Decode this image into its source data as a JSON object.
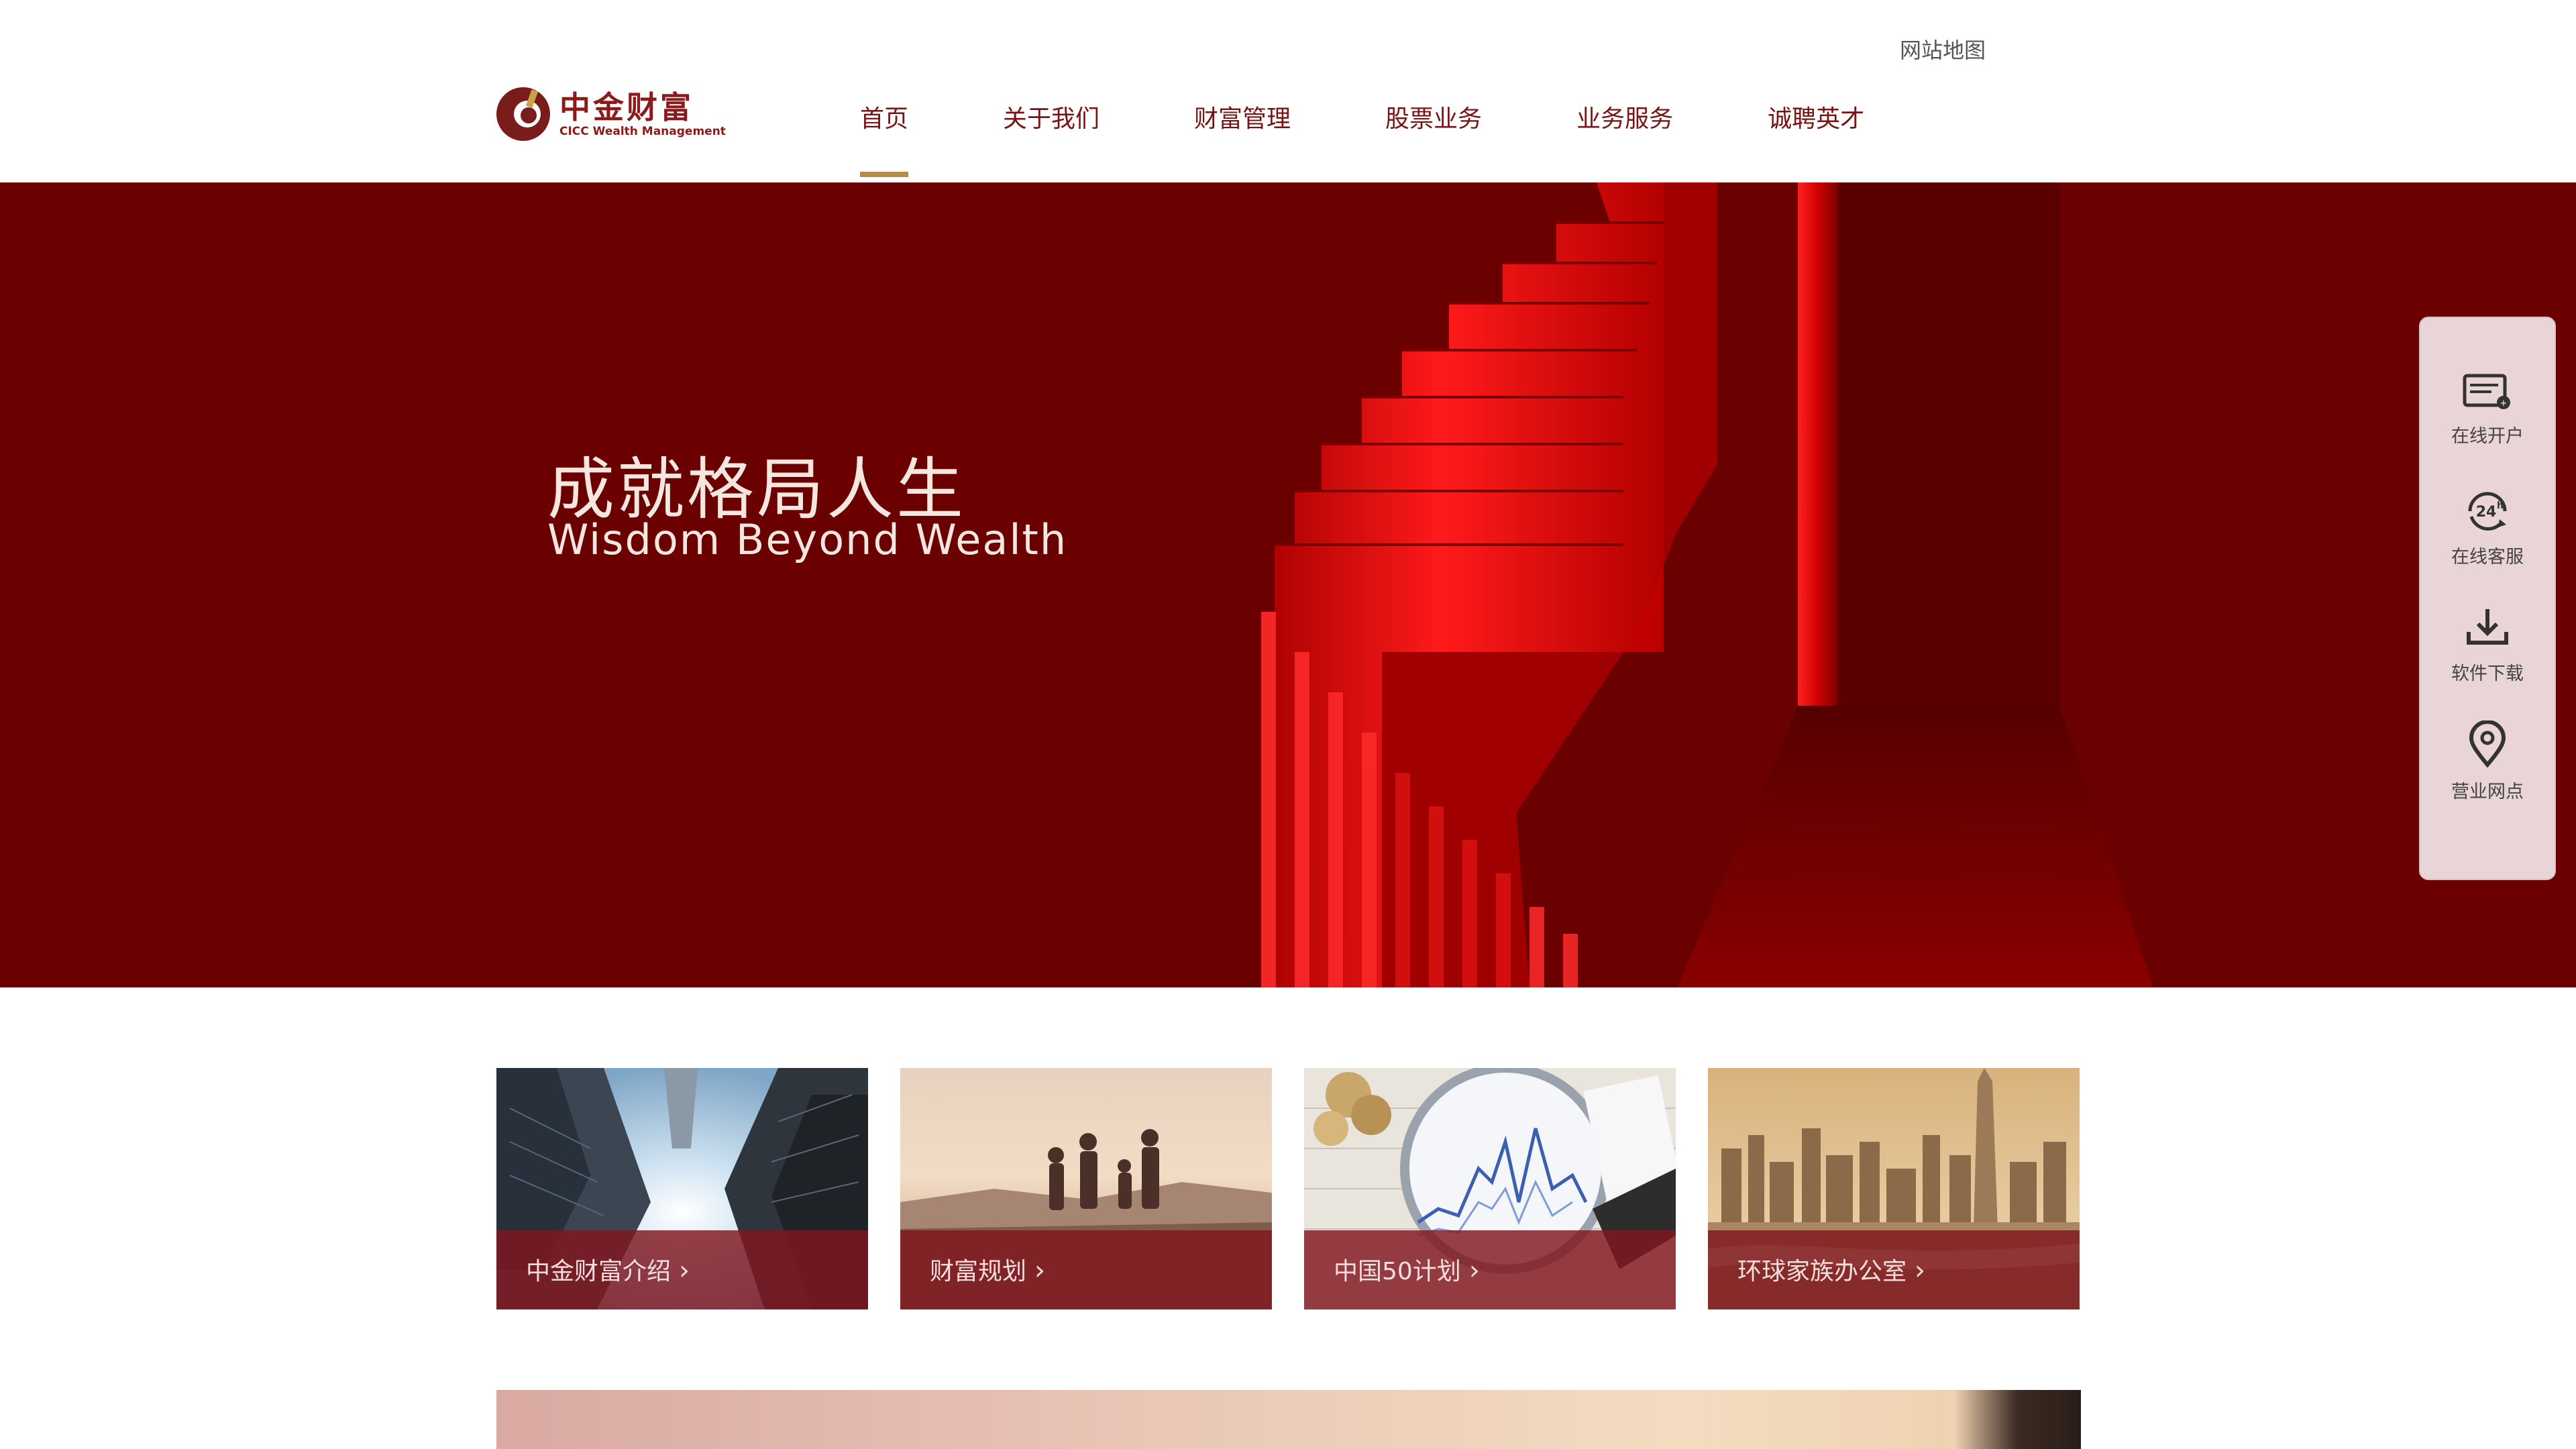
{
  "colors": {
    "brand": "#7a1414",
    "banner_bg": "#6b0000",
    "accent_gold": "#b58c4a",
    "card_caption_bg": "#80161e",
    "float_bar_bg": "#e9d4d8"
  },
  "header": {
    "sitemap_link": "网站地图",
    "logo": {
      "cn": "中金财富",
      "en": "CICC Wealth Management"
    },
    "nav": [
      {
        "label": "首页",
        "active": true
      },
      {
        "label": "关于我们",
        "active": false
      },
      {
        "label": "财富管理",
        "active": false
      },
      {
        "label": "股票业务",
        "active": false
      },
      {
        "label": "业务服务",
        "active": false
      },
      {
        "label": "诚聘英才",
        "active": false
      }
    ]
  },
  "banner": {
    "title": "成就格局人生",
    "subtitle": "Wisdom Beyond Wealth"
  },
  "float_bar": {
    "items": [
      {
        "label": "在线开户",
        "icon": "account-card-icon"
      },
      {
        "label": "在线客服",
        "icon": "24h-service-icon"
      },
      {
        "label": "软件下载",
        "icon": "download-icon"
      },
      {
        "label": "营业网点",
        "icon": "location-pin-icon"
      }
    ]
  },
  "cards": [
    {
      "label": "中金财富介绍",
      "image": "skyscrapers-looking-up"
    },
    {
      "label": "财富规划",
      "image": "family-hiking-sunset"
    },
    {
      "label": "中国50计划",
      "image": "magnifier-over-stock-chart"
    },
    {
      "label": "环球家族办公室",
      "image": "city-skyline"
    }
  ]
}
